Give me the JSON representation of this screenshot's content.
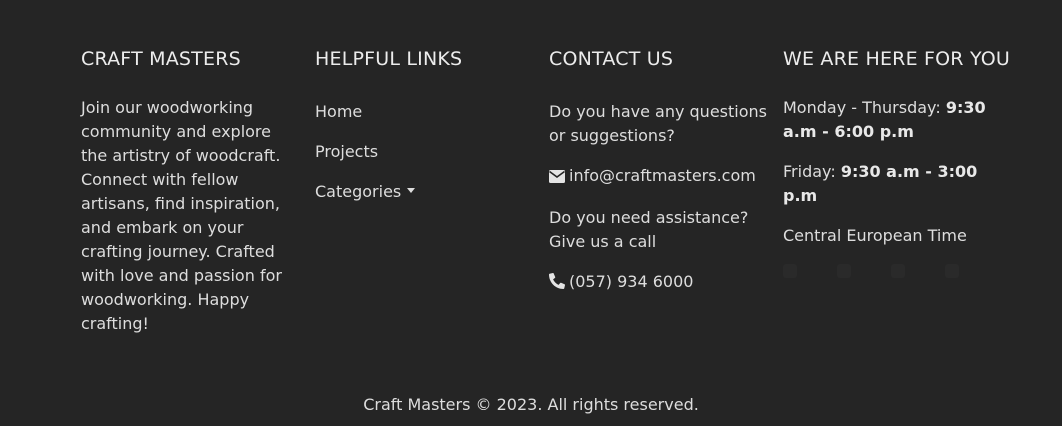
{
  "about": {
    "heading": "CRAFT MASTERS",
    "text": "Join our woodworking community and explore the artistry of woodcraft. Connect with fellow artisans, find inspiration, and embark on your crafting journey. Crafted with love and passion for woodworking. Happy crafting!"
  },
  "links": {
    "heading": "HELPFUL LINKS",
    "home": "Home",
    "projects": "Projects",
    "categories": "Categories"
  },
  "contact": {
    "heading": "CONTACT US",
    "question_text": "Do you have any questions or suggestions?",
    "email": "info@craftmasters.com",
    "assist_text": "Do you need assistance? Give us a call",
    "phone": "(057) 934 6000",
    "email_icon": "envelope-icon",
    "phone_icon": "phone-icon"
  },
  "hours": {
    "heading": "WE ARE HERE FOR YOU",
    "weekday_label": "Monday - Thursday:",
    "weekday_time": "9:30 a.m - 6:00 p.m",
    "friday_label": "Friday:",
    "friday_time": "9:30 a.m - 3:00 p.m",
    "timezone": "Central European Time"
  },
  "footer": {
    "copyright": "Craft Masters © 2023. All rights reserved."
  }
}
